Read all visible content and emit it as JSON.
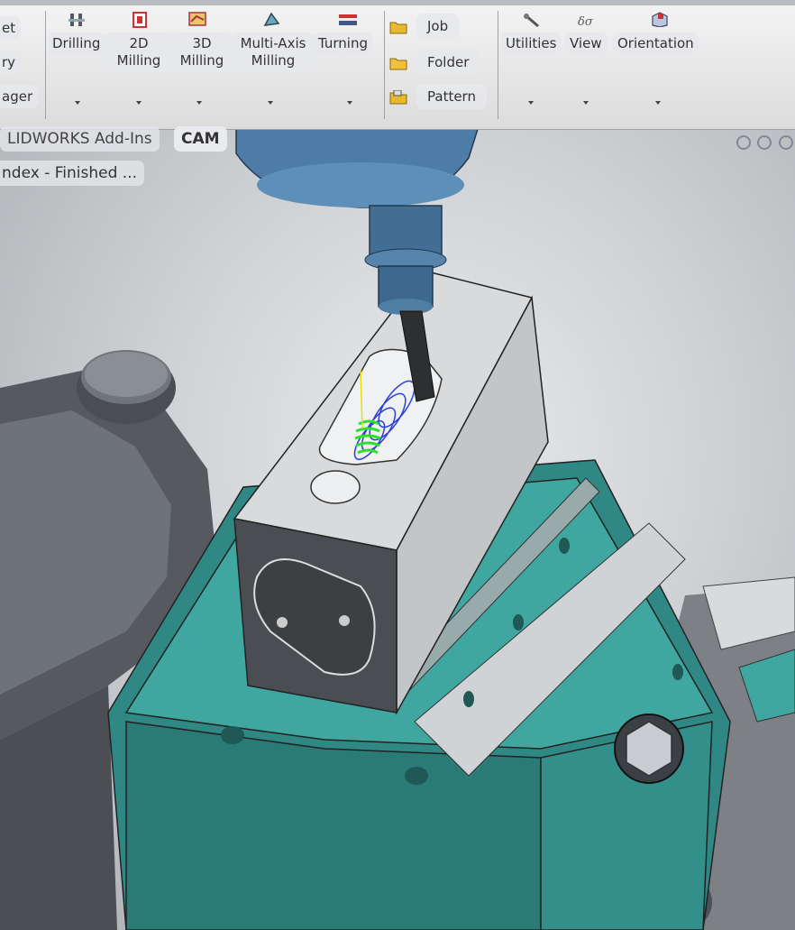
{
  "ribbon": {
    "left_clipped": {
      "item1": "et",
      "item2": "ry",
      "item3": "ager"
    },
    "buttons": {
      "drilling": "Drilling",
      "milling_2d_line1": "2D",
      "milling_2d_line2": "Milling",
      "milling_3d_line1": "3D",
      "milling_3d_line2": "Milling",
      "multiaxis_line1": "Multi-Axis",
      "multiaxis_line2": "Milling",
      "turning": "Turning",
      "job": "Job",
      "folder": "Folder",
      "pattern": "Pattern",
      "utilities": "Utilities",
      "view": "View",
      "orientation": "Orientation"
    }
  },
  "tabs": {
    "addins": "LIDWORKS Add-Ins",
    "cam": "CAM"
  },
  "tree": {
    "item": "ndex - Finished ..."
  },
  "colors": {
    "vise_teal": "#3fa6a0",
    "spindle_blue": "#4d7da6",
    "toolpath_blue": "#2b3fd1",
    "toolpath_green": "#2ee02e",
    "part_gray": "#d8dadc"
  }
}
